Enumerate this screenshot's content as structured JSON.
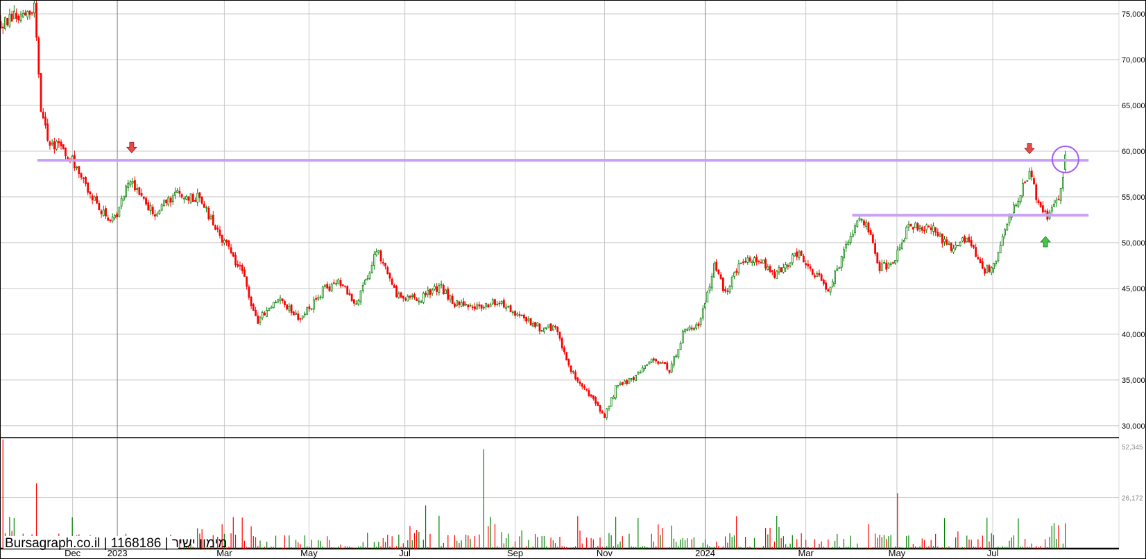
{
  "chart_data": {
    "type": "candlestick",
    "title": "",
    "watermark": "Bursagraph.co.il | 1168186 | מימון ישיר",
    "x_unit": "days since 2022-10-20",
    "xlim": [
      0,
      700
    ],
    "ylim": [
      28700,
      76440
    ],
    "y_ticks": [
      30000,
      35000,
      40000,
      45000,
      50000,
      55000,
      60000,
      65000,
      70000,
      75000
    ],
    "y_tick_labels": [
      "30,000",
      "35,000",
      "40,000",
      "45,000",
      "50,000",
      "55,000",
      "60,000",
      "65,000",
      "70,000",
      "75,000"
    ],
    "x_ticks": [
      {
        "day": 45,
        "label": "Dec",
        "year": false
      },
      {
        "day": 73,
        "label": "2023",
        "year": true
      },
      {
        "day": 140,
        "label": "Mar",
        "year": false
      },
      {
        "day": 193,
        "label": "May",
        "year": false
      },
      {
        "day": 253,
        "label": "Jul",
        "year": false
      },
      {
        "day": 322,
        "label": "Sep",
        "year": false
      },
      {
        "day": 378,
        "label": "Nov",
        "year": false
      },
      {
        "day": 441,
        "label": "2024",
        "year": true
      },
      {
        "day": 504,
        "label": "Mar",
        "year": false
      },
      {
        "day": 561,
        "label": "May",
        "year": false
      },
      {
        "day": 621,
        "label": "Jul",
        "year": false
      }
    ],
    "close_path": [
      [
        0,
        74000
      ],
      [
        21,
        75500
      ],
      [
        23,
        71500
      ],
      [
        25,
        64500
      ],
      [
        30,
        61200
      ],
      [
        37,
        60400
      ],
      [
        46,
        58800
      ],
      [
        55,
        55600
      ],
      [
        66,
        52800
      ],
      [
        71,
        52500
      ],
      [
        78,
        55600
      ],
      [
        82,
        56400
      ],
      [
        96,
        53200
      ],
      [
        110,
        55200
      ],
      [
        124,
        54900
      ],
      [
        137,
        50900
      ],
      [
        151,
        46900
      ],
      [
        160,
        41400
      ],
      [
        174,
        43800
      ],
      [
        188,
        41700
      ],
      [
        202,
        44900
      ],
      [
        213,
        45700
      ],
      [
        222,
        43000
      ],
      [
        236,
        49300
      ],
      [
        247,
        44500
      ],
      [
        261,
        43700
      ],
      [
        275,
        45300
      ],
      [
        284,
        43300
      ],
      [
        302,
        42900
      ],
      [
        311,
        43700
      ],
      [
        325,
        42100
      ],
      [
        339,
        40500
      ],
      [
        348,
        40900
      ],
      [
        355,
        36500
      ],
      [
        366,
        34100
      ],
      [
        378,
        30900
      ],
      [
        385,
        34100
      ],
      [
        394,
        34900
      ],
      [
        408,
        37300
      ],
      [
        419,
        36100
      ],
      [
        428,
        40500
      ],
      [
        437,
        40900
      ],
      [
        447,
        47700
      ],
      [
        453,
        44500
      ],
      [
        463,
        47700
      ],
      [
        472,
        48500
      ],
      [
        485,
        46500
      ],
      [
        499,
        48900
      ],
      [
        508,
        46900
      ],
      [
        518,
        44900
      ],
      [
        527,
        48500
      ],
      [
        536,
        52500
      ],
      [
        543,
        51700
      ],
      [
        550,
        47300
      ],
      [
        559,
        47700
      ],
      [
        568,
        51700
      ],
      [
        582,
        51700
      ],
      [
        595,
        49300
      ],
      [
        605,
        50500
      ],
      [
        616,
        46900
      ],
      [
        623,
        47700
      ],
      [
        632,
        53200
      ],
      [
        641,
        56400
      ],
      [
        645,
        58000
      ],
      [
        648,
        54900
      ],
      [
        655,
        52900
      ],
      [
        662,
        54900
      ],
      [
        665,
        57200
      ],
      [
        667,
        59600
      ]
    ],
    "volume": {
      "ylim": [
        0,
        52345
      ],
      "y_tick_labels": [
        "26,172",
        "52,345"
      ],
      "y_ticks": [
        26172,
        52345
      ],
      "spikes": [
        [
          1,
          56000,
          "down"
        ],
        [
          22,
          33500,
          "down"
        ],
        [
          302,
          51000,
          "up"
        ],
        [
          266,
          22200,
          "up"
        ],
        [
          562,
          28400,
          "down"
        ],
        [
          667,
          13000,
          "up"
        ]
      ]
    },
    "horizontal_lines": [
      {
        "price": 59000,
        "from_day": 23,
        "to_day": 681,
        "color": "#c9a0f5"
      },
      {
        "price": 53000,
        "from_day": 533,
        "to_day": 681,
        "color": "#c9a0f5"
      }
    ],
    "markers": [
      {
        "type": "down-arrow",
        "day": 82,
        "price": 59900,
        "color": "#e84a4a"
      },
      {
        "type": "down-arrow",
        "day": 644,
        "price": 59800,
        "color": "#e84a4a"
      },
      {
        "type": "up-arrow",
        "day": 654,
        "price": 50600,
        "color": "#44c744"
      },
      {
        "type": "circle",
        "day": 666.5,
        "price": 59100,
        "color": "#a45cf0"
      }
    ],
    "colors": {
      "up": "#008000",
      "down": "#ff0000",
      "grid": "#c8c8c8",
      "year_grid": "#808080"
    }
  }
}
